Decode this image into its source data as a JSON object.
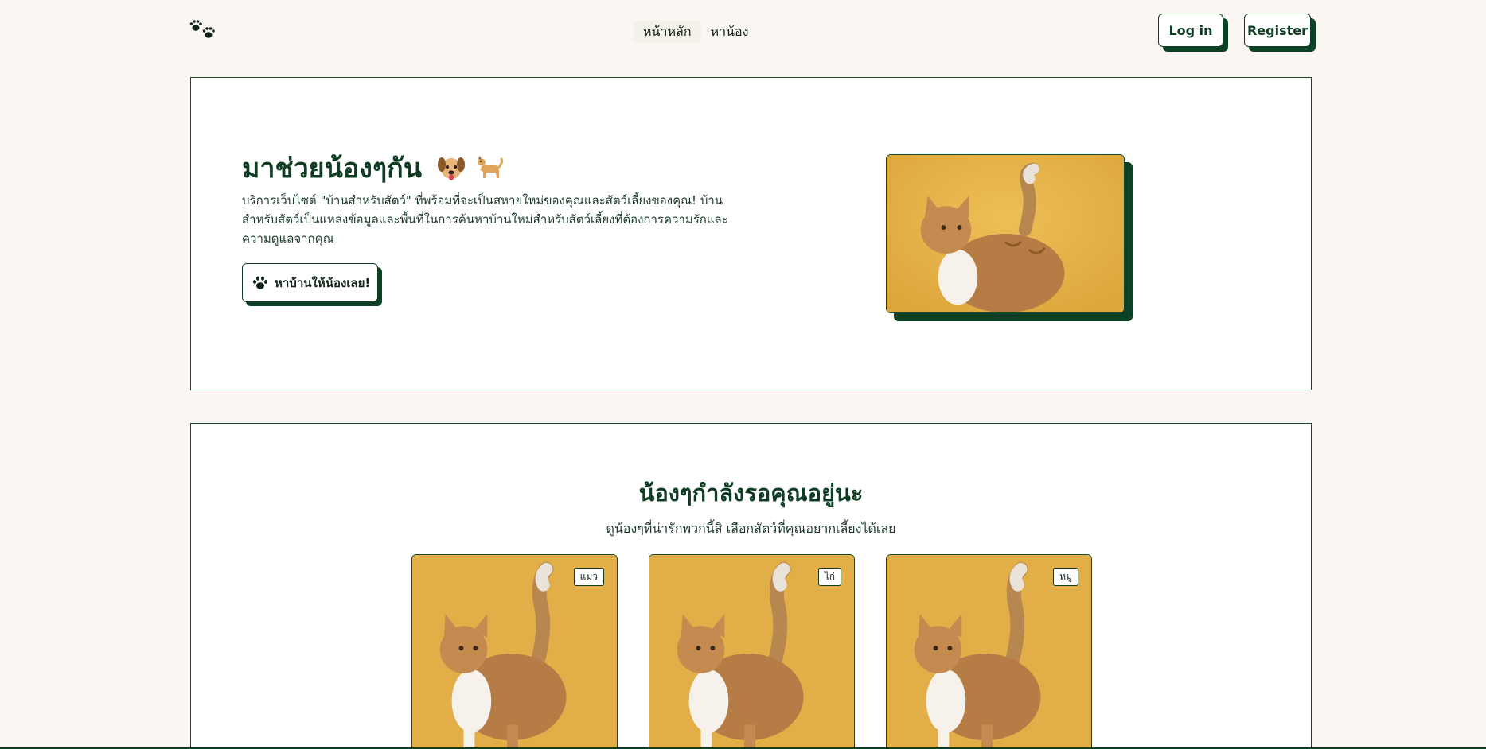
{
  "header": {
    "logo_icon": "paw-prints-icon",
    "nav": [
      {
        "label": "หน้าหลัก",
        "active": true
      },
      {
        "label": "หาน้อง",
        "active": false
      }
    ],
    "login_label": "Log in",
    "register_label": "Register"
  },
  "hero": {
    "title": "มาช่วยน้องๆกัน",
    "emoji_icons": [
      "dog-face-icon",
      "dog-icon"
    ],
    "description": "บริการเว็บไซต์ \"บ้านสำหรับสัตว์\" ที่พร้อมที่จะเป็นสหายใหม่ของคุณและสัตว์เลี้ยงของคุณ! บ้านสำหรับสัตว์เป็นแหล่งข้อมูลและพื้นที่ในการค้นหาบ้านใหม่สำหรับสัตว์เลี้ยงที่ต้องการความรักและความดูแลจากคุณ",
    "cta_label": "หาบ้านให้น้องเลย!",
    "cta_icon": "paw-icon",
    "image": "orange-cat-photo"
  },
  "pets": {
    "title": "น้องๆกำลังรอคุณอยู่นะ",
    "subtitle": "ดูน้องๆที่น่ารักพวกนี้สิ เลือกสัตว์ที่คุณอยากเลี้ยงได้เลย",
    "cards": [
      {
        "tag": "แมว",
        "image": "orange-cat-photo"
      },
      {
        "tag": "ไก่",
        "image": "orange-cat-photo"
      },
      {
        "tag": "หมู",
        "image": "orange-cat-photo"
      }
    ]
  },
  "colors": {
    "background": "#faf7f2",
    "primary_green": "#0f3d22",
    "shadow_green": "#0b4124",
    "photo_bg": "#e8b64a"
  }
}
